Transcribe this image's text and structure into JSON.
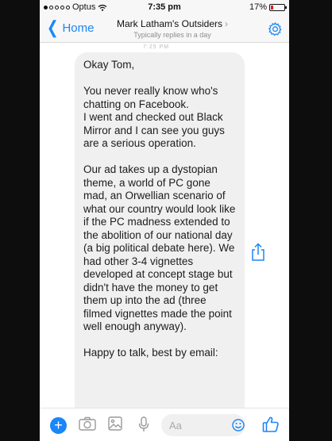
{
  "status_bar": {
    "carrier": "Optus",
    "time": "7:35 pm",
    "battery": "17%",
    "battery_level": 0.17
  },
  "header": {
    "back_label": "Home",
    "chat_name": "Mark Latham's Outsiders",
    "subtitle": "Typically replies in a day",
    "settings_icon": "gear-icon"
  },
  "message": {
    "timestamp": "7:25 PM",
    "text": "Okay Tom,\n\nYou never really know who's chatting on Facebook.\nI went and checked out Black Mirror and I can see you guys are a serious operation.\n\nOur ad takes up a dystopian theme, a world of PC gone mad, an Orwellian scenario of what our country would look like if the PC madness extended to the abolition of our national day (a big political debate here). We had other 3-4 vignettes developed at concept stage but didn't have the money to get them up into the ad (three filmed vignettes made the point well enough anyway).\n\nHappy to talk, best by email:"
  },
  "composer": {
    "placeholder": "Aa",
    "icons": [
      "plus-icon",
      "camera-icon",
      "image-icon",
      "microphone-icon",
      "emoji-icon",
      "thumbs-up-icon"
    ]
  },
  "colors": {
    "accent": "#1a86f7",
    "bubble": "#f1f0f0",
    "battery_low": "#e0191b"
  }
}
